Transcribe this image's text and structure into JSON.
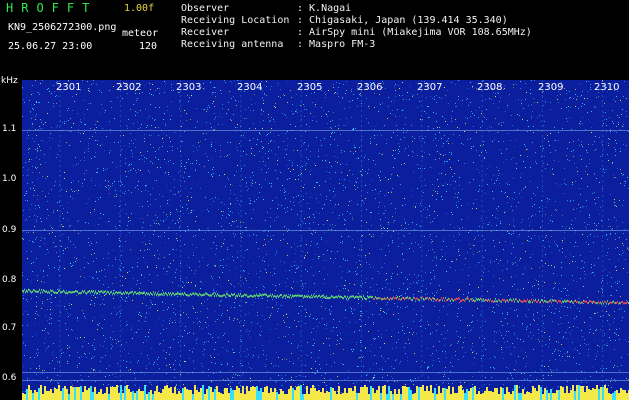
{
  "header": {
    "brand": "HROFFT",
    "version": "1.00f",
    "filename": "KN9_2506272300.png",
    "mode": "meteor",
    "datetime": "25.06.27 23:00",
    "count": "120",
    "rows": [
      {
        "label": "Observer",
        "value": ": K.Nagai"
      },
      {
        "label": "Receiving Location",
        "value": ": Chigasaki, Japan (139.414 35.340)"
      },
      {
        "label": "Receiver",
        "value": ": AirSpy mini (Miakejima VOR 108.65MHz)"
      },
      {
        "label": "Receiving antenna",
        "value": ": Maspro FM-3"
      }
    ]
  },
  "axis": {
    "unit": "kHz",
    "y_ticks": [
      "1.1",
      "1.0",
      "0.9",
      "0.8",
      "0.7",
      "0.6"
    ],
    "time_marks": [
      "2301",
      "2302",
      "2303",
      "2304",
      "2305",
      "2306",
      "2307",
      "2308",
      "2309",
      "2310"
    ]
  },
  "colors": {
    "background": "#0a1e9e",
    "noise_cyan": "#35e0ff",
    "noise_yellow": "#f5e94a",
    "trace_green": "#6fe86a",
    "trace_red": "#ff5050",
    "brand_green": "#33e64d",
    "version_yellow": "#e8d640"
  }
}
